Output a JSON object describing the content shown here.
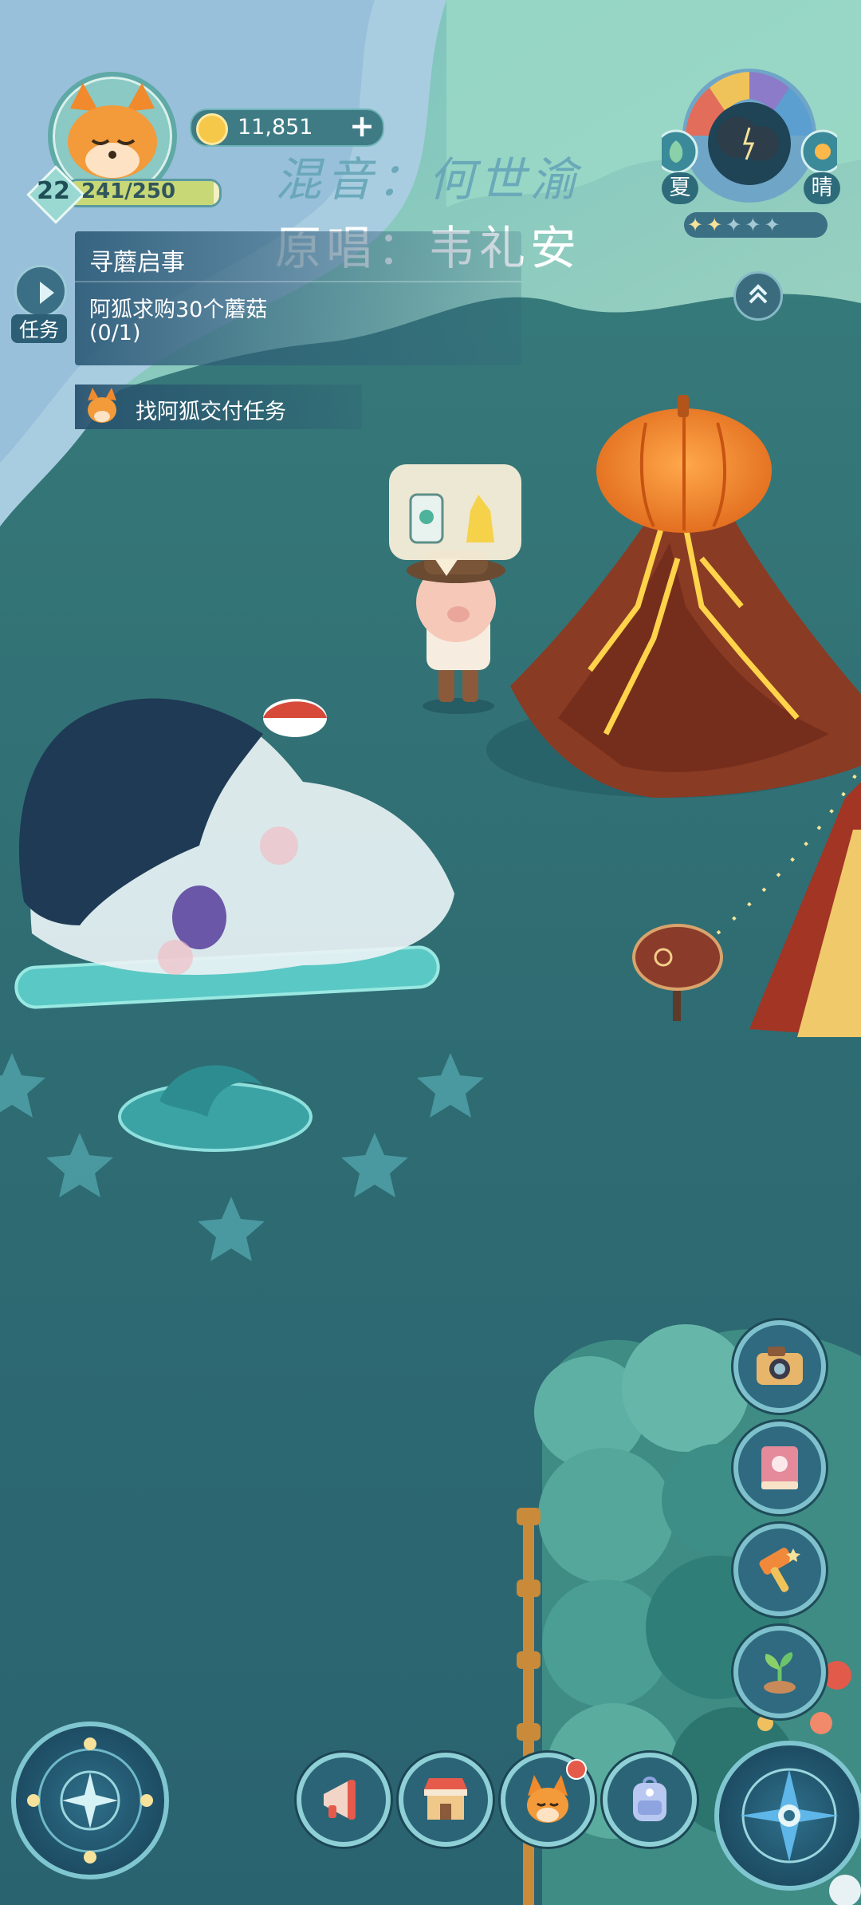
{
  "player": {
    "level": "22",
    "xp_text": "241/250",
    "xp_fraction": 0.964,
    "avatar_icon": "fox-avatar-icon"
  },
  "currency": {
    "coins": "11,851",
    "add_label": "+"
  },
  "watermark": {
    "line1": "混音：何世渝",
    "line2": "原唱：韦礼安"
  },
  "quest": {
    "button_label": "任务",
    "title": "寻蘑启事",
    "description": "阿狐求购30个蘑菇",
    "progress": "(0/1)",
    "subtask": "找阿狐交付任务"
  },
  "weather": {
    "season": "夏",
    "condition": "晴",
    "stars_filled": 2,
    "stars_total": 5
  },
  "right_toolbar": [
    "camera-icon",
    "book-icon",
    "hammer-icon",
    "sprout-icon"
  ],
  "bottom_bar": [
    "megaphone-icon",
    "shop-icon",
    "fox-friend-icon",
    "backpack-icon"
  ],
  "colors": {
    "panel": "#2e5c78",
    "accent": "#7ec1cd",
    "ground": "#2f6d73"
  }
}
